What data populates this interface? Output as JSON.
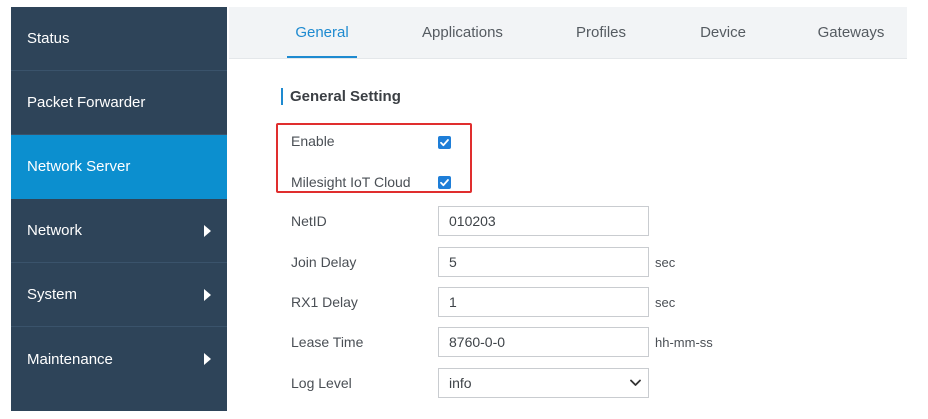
{
  "sidebar": {
    "items": [
      {
        "label": "Status",
        "active": false,
        "has_submenu": false
      },
      {
        "label": "Packet Forwarder",
        "active": false,
        "has_submenu": false
      },
      {
        "label": "Network Server",
        "active": true,
        "has_submenu": false
      },
      {
        "label": "Network",
        "active": false,
        "has_submenu": true
      },
      {
        "label": "System",
        "active": false,
        "has_submenu": true
      },
      {
        "label": "Maintenance",
        "active": false,
        "has_submenu": true
      }
    ]
  },
  "tabs": [
    {
      "label": "General",
      "active": true
    },
    {
      "label": "Applications",
      "active": false
    },
    {
      "label": "Profiles",
      "active": false
    },
    {
      "label": "Device",
      "active": false
    },
    {
      "label": "Gateways",
      "active": false
    }
  ],
  "section": {
    "title": "General Setting"
  },
  "form": {
    "enable": {
      "label": "Enable",
      "checked": true
    },
    "milesight_cloud": {
      "label": "Milesight IoT Cloud",
      "checked": true
    },
    "netid": {
      "label": "NetID",
      "value": "010203"
    },
    "join_delay": {
      "label": "Join Delay",
      "value": "5",
      "unit": "sec"
    },
    "rx1_delay": {
      "label": "RX1 Delay",
      "value": "1",
      "unit": "sec"
    },
    "lease_time": {
      "label": "Lease Time",
      "value": "8760-0-0",
      "unit": "hh-mm-ss"
    },
    "log_level": {
      "label": "Log Level",
      "value": "info"
    }
  },
  "colors": {
    "sidebar_bg": "#2e4459",
    "sidebar_active": "#0c8fcf",
    "accent": "#1e8ad0",
    "highlight_border": "#e02e2e",
    "checkbox": "#1e7ed8"
  }
}
